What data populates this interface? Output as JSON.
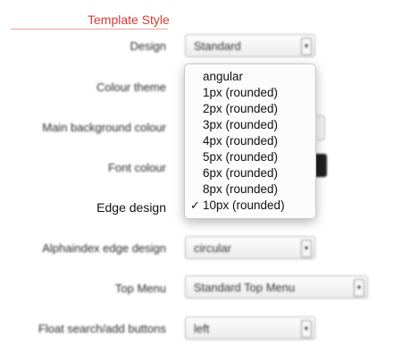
{
  "section_title": "Template Style",
  "fields": {
    "design": {
      "label": "Design",
      "value": "Standard"
    },
    "colour_theme": {
      "label": "Colour theme"
    },
    "main_background_colour": {
      "label": "Main background colour"
    },
    "font_colour": {
      "label": "Font colour"
    },
    "edge_design": {
      "label": "Edge design"
    },
    "alphaindex_edge_design": {
      "label": "Alphaindex edge design",
      "value": "circular"
    },
    "top_menu": {
      "label": "Top Menu",
      "value": "Standard Top Menu"
    },
    "float_search_add_buttons": {
      "label": "Float search/add buttons",
      "value": "left"
    }
  },
  "edge_design_menu": {
    "options": [
      "angular",
      "1px (rounded)",
      "2px (rounded)",
      "3px (rounded)",
      "4px (rounded)",
      "5px (rounded)",
      "6px (rounded)",
      "8px (rounded)",
      "10px (rounded)"
    ],
    "selected": "10px (rounded)",
    "check_glyph": "✓"
  },
  "icons": {
    "select_arrow": "select-arrow-icon",
    "check": "checkmark-icon"
  },
  "colors": {
    "accent": "#d8392f",
    "swatch_font_colour": "#1f1f1f"
  }
}
